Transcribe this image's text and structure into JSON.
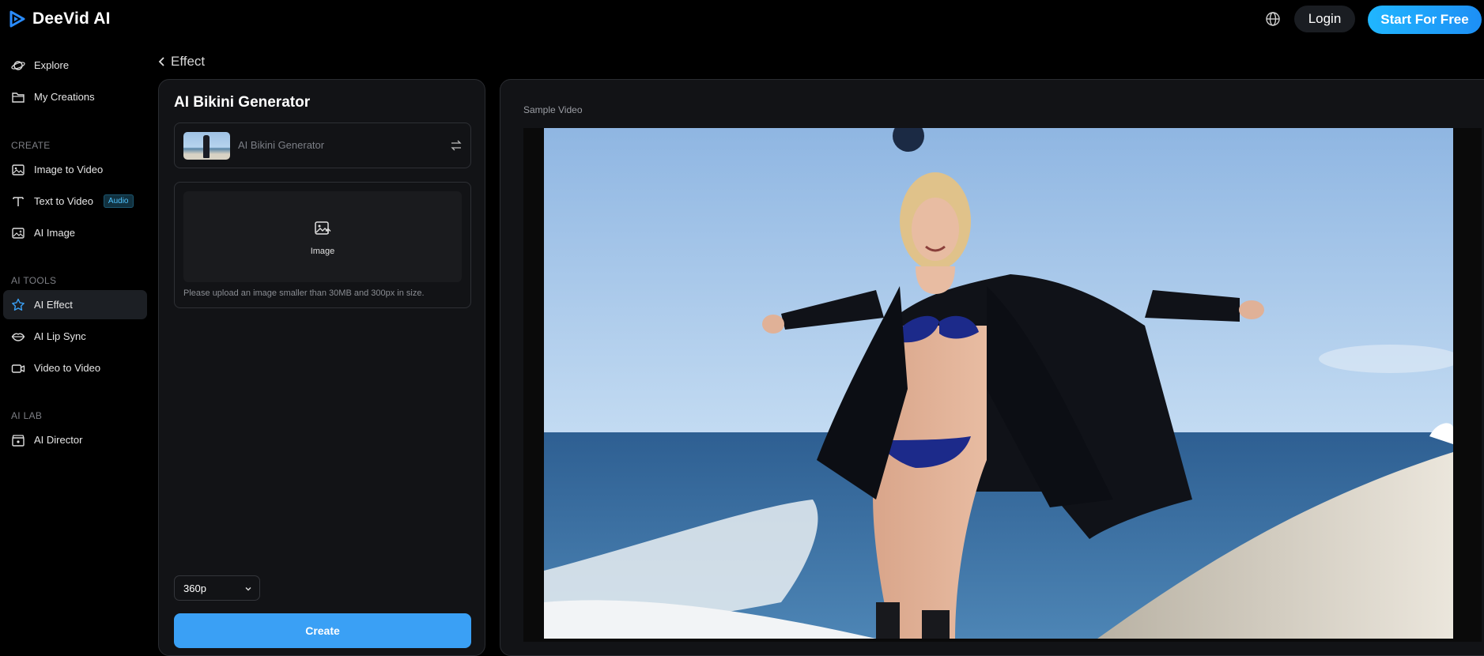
{
  "header": {
    "brand": "DeeVid AI",
    "login_label": "Login",
    "start_label": "Start For Free",
    "icons": {
      "logo": "deevid-play-logo-icon",
      "language": "globe-icon"
    }
  },
  "sidebar": {
    "top_items": [
      {
        "label": "Explore",
        "icon": "planet-icon"
      },
      {
        "label": "My Creations",
        "icon": "folder-icon"
      }
    ],
    "create_label": "CREATE",
    "create_items": [
      {
        "label": "Image to Video",
        "icon": "image-icon"
      },
      {
        "label": "Text to Video",
        "icon": "text-icon",
        "badge": "Audio"
      },
      {
        "label": "AI Image",
        "icon": "ai-image-icon"
      }
    ],
    "tools_label": "AI TOOLS",
    "tools_items": [
      {
        "label": "AI Effect",
        "icon": "star-icon",
        "active": true
      },
      {
        "label": "AI Lip Sync",
        "icon": "lips-icon"
      },
      {
        "label": "Video to Video",
        "icon": "video-camera-icon"
      }
    ],
    "lab_label": "AI LAB",
    "lab_items": [
      {
        "label": "AI Director",
        "icon": "clapper-icon"
      }
    ]
  },
  "breadcrumb": {
    "back_label": "Effect"
  },
  "generator": {
    "title": "AI Bikini Generator",
    "effect_name": "AI Bikini Generator",
    "upload_label": "Image",
    "upload_hint": "Please upload an image smaller than 30MB and 300px in size.",
    "resolution": "360p",
    "create_label": "Create"
  },
  "preview": {
    "label": "Sample Video"
  },
  "colors": {
    "accent": "#3aa0f5",
    "start_gradient_from": "#20b6ff",
    "start_gradient_to": "#1d8ff5",
    "badge_text": "#4fc3ff"
  }
}
